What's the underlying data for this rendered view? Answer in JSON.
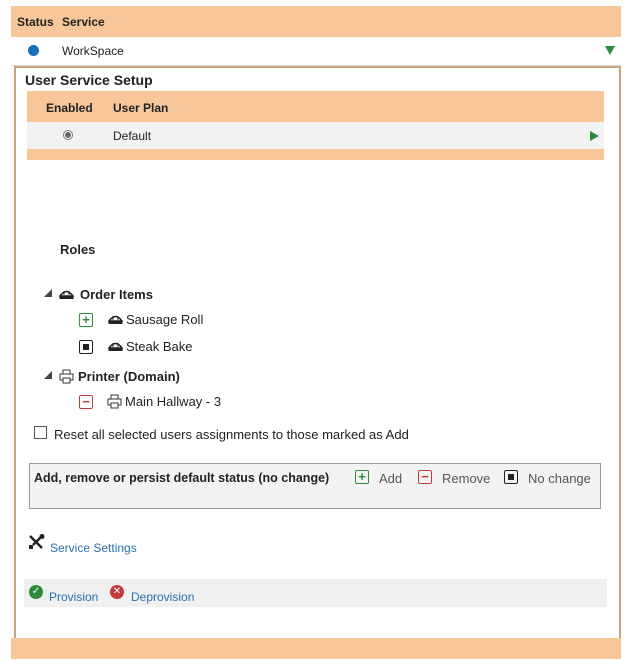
{
  "service_table": {
    "headers": {
      "status": "Status",
      "service": "Service"
    },
    "row": {
      "service": "WorkSpace"
    }
  },
  "user_service_setup": {
    "title": "User Service Setup",
    "headers": {
      "enabled": "Enabled",
      "user_plan": "User Plan"
    },
    "row": {
      "plan": "Default"
    }
  },
  "roles": {
    "heading": "Roles",
    "groups": [
      {
        "name": "Order Items",
        "icon": "pie-icon",
        "items": [
          {
            "name": "Sausage Roll",
            "state": "add"
          },
          {
            "name": "Steak Bake",
            "state": "no-change"
          }
        ]
      },
      {
        "name": "Printer (Domain)",
        "icon": "printer-icon",
        "items": [
          {
            "name": "Main Hallway - 3",
            "state": "remove"
          }
        ]
      }
    ]
  },
  "reset_checkbox": {
    "label": "Reset all selected users assignments to those marked as Add",
    "checked": false
  },
  "legend": {
    "title": "Add, remove or persist default status (no change)",
    "add": "Add",
    "remove": "Remove",
    "no_change": "No change"
  },
  "service_settings": {
    "label": "Service Settings"
  },
  "actions": {
    "provision": "Provision",
    "deprovision": "Deprovision"
  },
  "colors": {
    "header_orange": "#f7c79a",
    "status_dot": "#1a6fb5",
    "add_green": "#2e8b3a",
    "remove_red": "#c23b3b",
    "link_blue": "#2a6fb0"
  }
}
